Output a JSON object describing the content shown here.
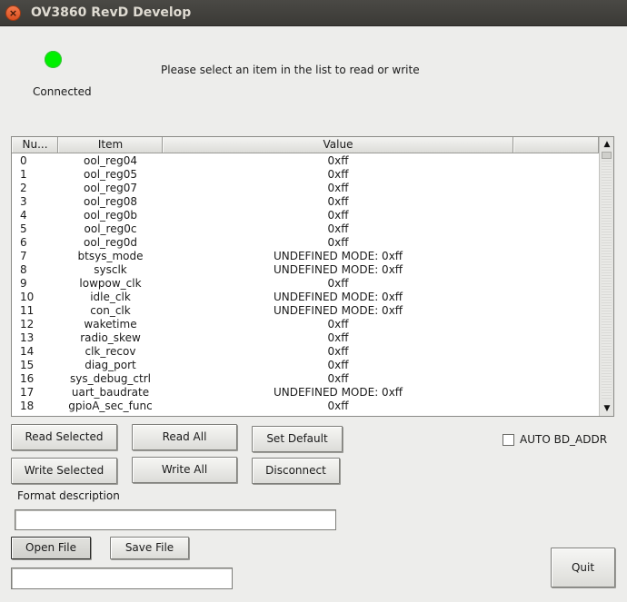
{
  "window": {
    "title": "OV3860 RevD Develop",
    "close_glyph": "×"
  },
  "status": {
    "label": "Connected",
    "led_color": "#00f000",
    "led_icon": "status-led-icon"
  },
  "instruction": "Please select an item in the list to read or write",
  "table": {
    "columns": {
      "num": "Nu...",
      "item": "Item",
      "value": "Value",
      "extra": ""
    },
    "rows": [
      {
        "num": "0",
        "item": "ool_reg04",
        "value": "0xff"
      },
      {
        "num": "1",
        "item": "ool_reg05",
        "value": "0xff"
      },
      {
        "num": "2",
        "item": "ool_reg07",
        "value": "0xff"
      },
      {
        "num": "3",
        "item": "ool_reg08",
        "value": "0xff"
      },
      {
        "num": "4",
        "item": "ool_reg0b",
        "value": "0xff"
      },
      {
        "num": "5",
        "item": "ool_reg0c",
        "value": "0xff"
      },
      {
        "num": "6",
        "item": "ool_reg0d",
        "value": "0xff"
      },
      {
        "num": "7",
        "item": "btsys_mode",
        "value": "UNDEFINED MODE: 0xff"
      },
      {
        "num": "8",
        "item": "sysclk",
        "value": "UNDEFINED MODE: 0xff"
      },
      {
        "num": "9",
        "item": "lowpow_clk",
        "value": "0xff"
      },
      {
        "num": "10",
        "item": "idle_clk",
        "value": "UNDEFINED MODE: 0xff"
      },
      {
        "num": "11",
        "item": "con_clk",
        "value": "UNDEFINED MODE: 0xff"
      },
      {
        "num": "12",
        "item": "waketime",
        "value": "0xff"
      },
      {
        "num": "13",
        "item": "radio_skew",
        "value": "0xff"
      },
      {
        "num": "14",
        "item": "clk_recov",
        "value": "0xff"
      },
      {
        "num": "15",
        "item": "diag_port",
        "value": "0xff"
      },
      {
        "num": "16",
        "item": "sys_debug_ctrl",
        "value": "0xff"
      },
      {
        "num": "17",
        "item": "uart_baudrate",
        "value": "UNDEFINED MODE: 0xff"
      },
      {
        "num": "18",
        "item": "gpioA_sec_func",
        "value": "0xff"
      }
    ],
    "scroll": {
      "up_glyph": "▲",
      "down_glyph": "▼"
    }
  },
  "buttons": {
    "read_selected": "Read Selected",
    "read_all": "Read All",
    "set_default": "Set Default",
    "write_selected": "Write Selected",
    "write_all": "Write All",
    "disconnect": "Disconnect",
    "open_file": "Open File",
    "save_file": "Save File",
    "quit": "Quit"
  },
  "auto_bd_addr": {
    "label": "AUTO BD_ADDR",
    "checked": false
  },
  "format": {
    "label": "Format description",
    "value": ""
  },
  "file_path": {
    "value": ""
  }
}
